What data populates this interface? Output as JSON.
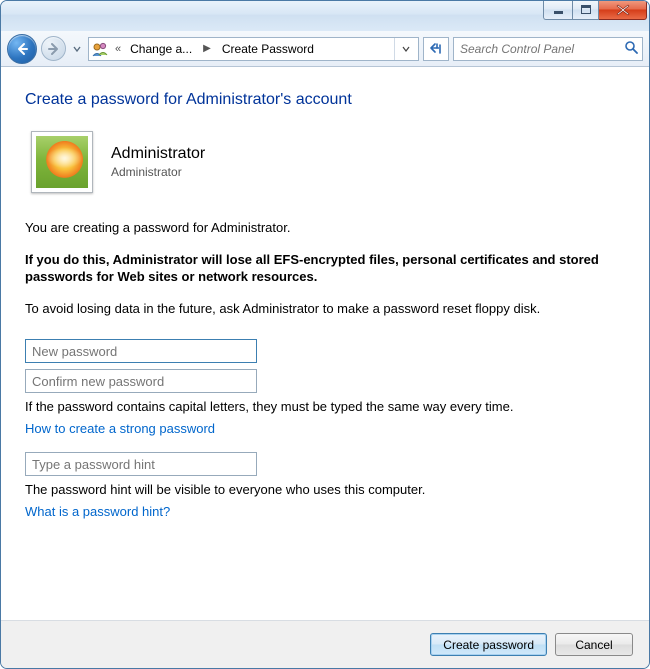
{
  "window": {
    "breadcrumb_prev": "Change a...",
    "breadcrumb_current": "Create Password",
    "search_placeholder": "Search Control Panel"
  },
  "page": {
    "title": "Create a password for Administrator's account",
    "user_name": "Administrator",
    "user_type": "Administrator",
    "intro": "You are creating a password for Administrator.",
    "warning": "If you do this, Administrator will lose all EFS-encrypted files, personal certificates and stored passwords for Web sites or network resources.",
    "avoid": "To avoid losing data in the future, ask Administrator to make a password reset floppy disk.",
    "placeholder_new": "New password",
    "placeholder_confirm": "Confirm new password",
    "caps_note": "If the password contains capital letters, they must be typed the same way every time.",
    "link_strong": "How to create a strong password",
    "placeholder_hint": "Type a password hint",
    "hint_note": "The password hint will be visible to everyone who uses this computer.",
    "link_hint": "What is a password hint?"
  },
  "buttons": {
    "create": "Create password",
    "cancel": "Cancel"
  }
}
